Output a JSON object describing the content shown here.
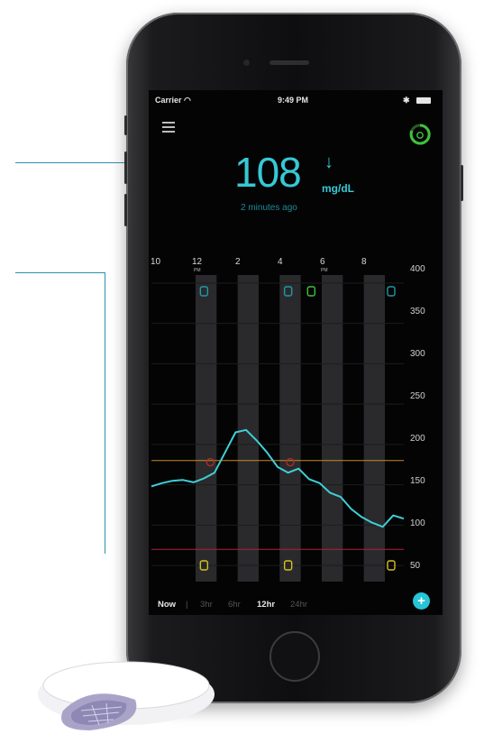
{
  "status_bar": {
    "carrier": "Carrier",
    "time": "9:49 PM"
  },
  "reading": {
    "value": "108",
    "trend_arrow": "↓",
    "unit": "mg/dL",
    "age": "2 minutes ago"
  },
  "time_axis": [
    {
      "label": "10",
      "pm": ""
    },
    {
      "label": "12",
      "pm": "PM"
    },
    {
      "label": "2",
      "pm": ""
    },
    {
      "label": "4",
      "pm": ""
    },
    {
      "label": "6",
      "pm": "PM"
    },
    {
      "label": "8",
      "pm": ""
    }
  ],
  "y_axis": [
    "400",
    "350",
    "300",
    "250",
    "200",
    "150",
    "100",
    "50"
  ],
  "range_selector": {
    "now": "Now",
    "options": [
      "3hr",
      "6hr",
      "12hr",
      "24hr"
    ],
    "selected": "12hr"
  },
  "add_button": "+",
  "colors": {
    "accent": "#37c8d4",
    "high_line": "#c98a1e",
    "low_line": "#b0203a",
    "event_green": "#3fc23a"
  },
  "chart_data": {
    "type": "line",
    "title": "",
    "xlabel": "",
    "ylabel": "",
    "unit": "mg/dL",
    "ylim": [
      30,
      410
    ],
    "x_range_hours": [
      9.5,
      21.5
    ],
    "thresholds": {
      "high": 180,
      "low": 70
    },
    "series": [
      {
        "x": [
          9.5,
          10.0,
          10.5,
          11.0,
          11.5,
          12.0,
          12.5,
          13.0,
          13.5,
          14.0,
          14.5,
          15.0,
          15.5,
          16.0,
          16.5,
          17.0,
          17.5,
          18.0,
          18.5,
          19.0,
          19.5,
          20.0,
          20.5,
          21.0,
          21.5
        ],
        "y": [
          148,
          152,
          155,
          156,
          153,
          158,
          165,
          190,
          215,
          218,
          205,
          190,
          172,
          165,
          170,
          157,
          152,
          140,
          135,
          120,
          110,
          103,
          98,
          112,
          108
        ]
      }
    ]
  }
}
